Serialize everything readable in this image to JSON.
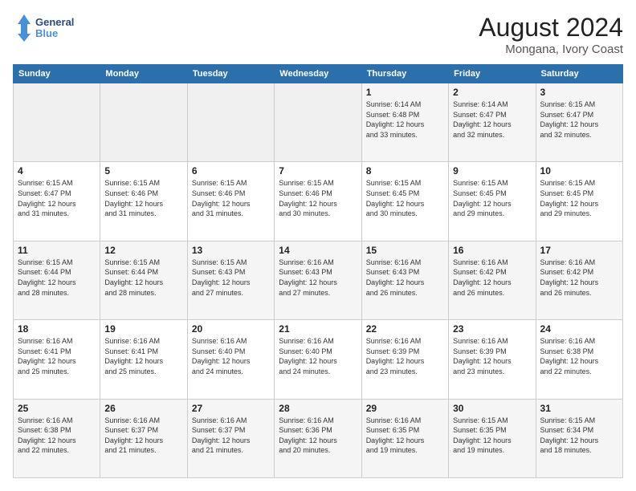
{
  "logo": {
    "line1": "General",
    "line2": "Blue"
  },
  "title": "August 2024",
  "subtitle": "Mongana, Ivory Coast",
  "weekdays": [
    "Sunday",
    "Monday",
    "Tuesday",
    "Wednesday",
    "Thursday",
    "Friday",
    "Saturday"
  ],
  "weeks": [
    [
      {
        "day": "",
        "info": ""
      },
      {
        "day": "",
        "info": ""
      },
      {
        "day": "",
        "info": ""
      },
      {
        "day": "",
        "info": ""
      },
      {
        "day": "1",
        "info": "Sunrise: 6:14 AM\nSunset: 6:48 PM\nDaylight: 12 hours\nand 33 minutes."
      },
      {
        "day": "2",
        "info": "Sunrise: 6:14 AM\nSunset: 6:47 PM\nDaylight: 12 hours\nand 32 minutes."
      },
      {
        "day": "3",
        "info": "Sunrise: 6:15 AM\nSunset: 6:47 PM\nDaylight: 12 hours\nand 32 minutes."
      }
    ],
    [
      {
        "day": "4",
        "info": "Sunrise: 6:15 AM\nSunset: 6:47 PM\nDaylight: 12 hours\nand 31 minutes."
      },
      {
        "day": "5",
        "info": "Sunrise: 6:15 AM\nSunset: 6:46 PM\nDaylight: 12 hours\nand 31 minutes."
      },
      {
        "day": "6",
        "info": "Sunrise: 6:15 AM\nSunset: 6:46 PM\nDaylight: 12 hours\nand 31 minutes."
      },
      {
        "day": "7",
        "info": "Sunrise: 6:15 AM\nSunset: 6:46 PM\nDaylight: 12 hours\nand 30 minutes."
      },
      {
        "day": "8",
        "info": "Sunrise: 6:15 AM\nSunset: 6:45 PM\nDaylight: 12 hours\nand 30 minutes."
      },
      {
        "day": "9",
        "info": "Sunrise: 6:15 AM\nSunset: 6:45 PM\nDaylight: 12 hours\nand 29 minutes."
      },
      {
        "day": "10",
        "info": "Sunrise: 6:15 AM\nSunset: 6:45 PM\nDaylight: 12 hours\nand 29 minutes."
      }
    ],
    [
      {
        "day": "11",
        "info": "Sunrise: 6:15 AM\nSunset: 6:44 PM\nDaylight: 12 hours\nand 28 minutes."
      },
      {
        "day": "12",
        "info": "Sunrise: 6:15 AM\nSunset: 6:44 PM\nDaylight: 12 hours\nand 28 minutes."
      },
      {
        "day": "13",
        "info": "Sunrise: 6:15 AM\nSunset: 6:43 PM\nDaylight: 12 hours\nand 27 minutes."
      },
      {
        "day": "14",
        "info": "Sunrise: 6:16 AM\nSunset: 6:43 PM\nDaylight: 12 hours\nand 27 minutes."
      },
      {
        "day": "15",
        "info": "Sunrise: 6:16 AM\nSunset: 6:43 PM\nDaylight: 12 hours\nand 26 minutes."
      },
      {
        "day": "16",
        "info": "Sunrise: 6:16 AM\nSunset: 6:42 PM\nDaylight: 12 hours\nand 26 minutes."
      },
      {
        "day": "17",
        "info": "Sunrise: 6:16 AM\nSunset: 6:42 PM\nDaylight: 12 hours\nand 26 minutes."
      }
    ],
    [
      {
        "day": "18",
        "info": "Sunrise: 6:16 AM\nSunset: 6:41 PM\nDaylight: 12 hours\nand 25 minutes."
      },
      {
        "day": "19",
        "info": "Sunrise: 6:16 AM\nSunset: 6:41 PM\nDaylight: 12 hours\nand 25 minutes."
      },
      {
        "day": "20",
        "info": "Sunrise: 6:16 AM\nSunset: 6:40 PM\nDaylight: 12 hours\nand 24 minutes."
      },
      {
        "day": "21",
        "info": "Sunrise: 6:16 AM\nSunset: 6:40 PM\nDaylight: 12 hours\nand 24 minutes."
      },
      {
        "day": "22",
        "info": "Sunrise: 6:16 AM\nSunset: 6:39 PM\nDaylight: 12 hours\nand 23 minutes."
      },
      {
        "day": "23",
        "info": "Sunrise: 6:16 AM\nSunset: 6:39 PM\nDaylight: 12 hours\nand 23 minutes."
      },
      {
        "day": "24",
        "info": "Sunrise: 6:16 AM\nSunset: 6:38 PM\nDaylight: 12 hours\nand 22 minutes."
      }
    ],
    [
      {
        "day": "25",
        "info": "Sunrise: 6:16 AM\nSunset: 6:38 PM\nDaylight: 12 hours\nand 22 minutes."
      },
      {
        "day": "26",
        "info": "Sunrise: 6:16 AM\nSunset: 6:37 PM\nDaylight: 12 hours\nand 21 minutes."
      },
      {
        "day": "27",
        "info": "Sunrise: 6:16 AM\nSunset: 6:37 PM\nDaylight: 12 hours\nand 21 minutes."
      },
      {
        "day": "28",
        "info": "Sunrise: 6:16 AM\nSunset: 6:36 PM\nDaylight: 12 hours\nand 20 minutes."
      },
      {
        "day": "29",
        "info": "Sunrise: 6:16 AM\nSunset: 6:35 PM\nDaylight: 12 hours\nand 19 minutes."
      },
      {
        "day": "30",
        "info": "Sunrise: 6:15 AM\nSunset: 6:35 PM\nDaylight: 12 hours\nand 19 minutes."
      },
      {
        "day": "31",
        "info": "Sunrise: 6:15 AM\nSunset: 6:34 PM\nDaylight: 12 hours\nand 18 minutes."
      }
    ]
  ]
}
